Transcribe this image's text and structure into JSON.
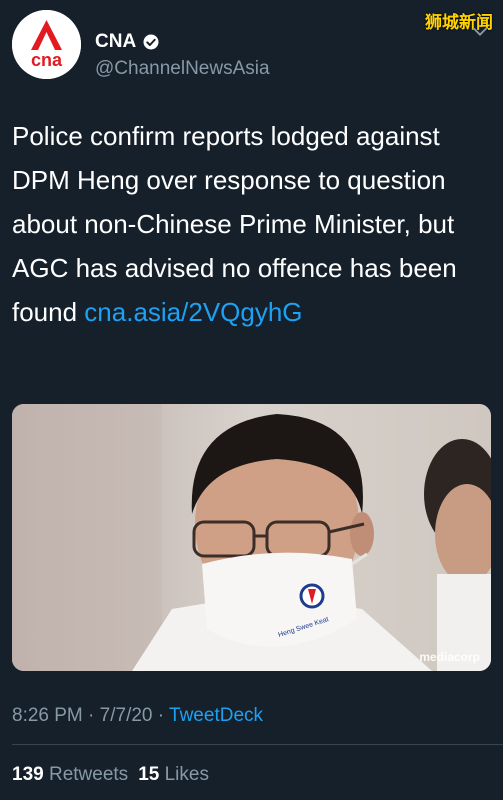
{
  "watermark": "狮城新闻",
  "account": {
    "display_name": "CNA",
    "handle": "@ChannelNewsAsia",
    "avatar_text": "cna"
  },
  "tweet": {
    "text": "Police confirm reports lodged against DPM Heng over response to question about non-Chinese Prime Minister, but AGC has advised no offence has been found ",
    "link": "cna.asia/2VQgyhG"
  },
  "media": {
    "mask_text": "Heng Swee Keat",
    "credit": "mediacorp"
  },
  "meta": {
    "time": "8:26 PM",
    "separator": " · ",
    "date": "7/7/20",
    "source": "TweetDeck"
  },
  "stats": {
    "retweets_count": "139",
    "retweets_label": "Retweets",
    "likes_count": "15",
    "likes_label": "Likes"
  },
  "colors": {
    "background": "#15202b",
    "link": "#1da1f2",
    "secondary_text": "#8899a6",
    "brand_red": "#e21b23",
    "watermark": "#ffd200"
  }
}
